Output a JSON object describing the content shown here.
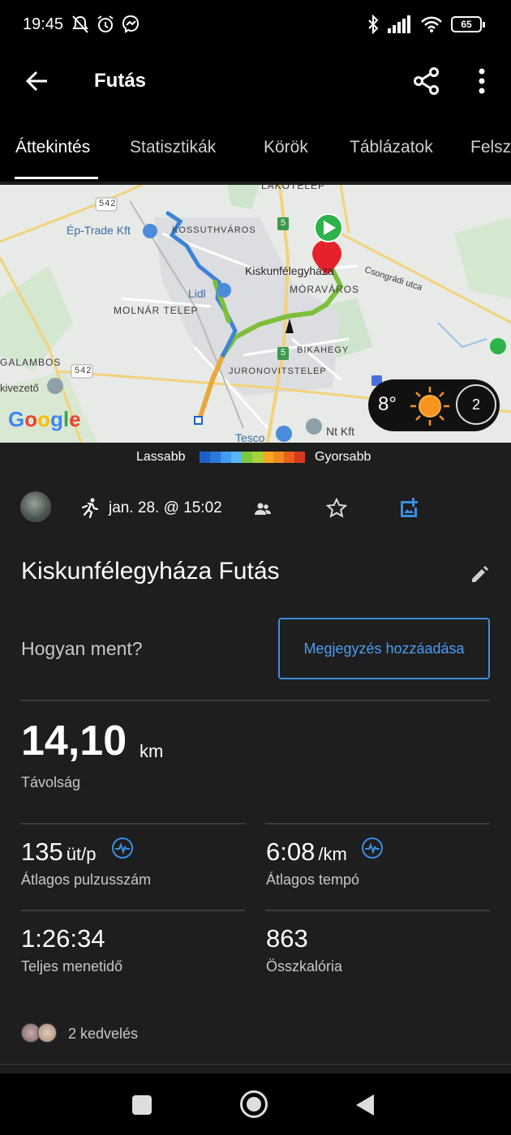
{
  "status_bar": {
    "time": "19:45",
    "battery": "65",
    "icons": [
      "mute-bell-icon",
      "alarm-icon",
      "messenger-icon",
      "bluetooth-icon",
      "signal-icon",
      "wifi-icon",
      "battery-icon"
    ]
  },
  "app_bar": {
    "title": "Futás",
    "icons": [
      "back-arrow-icon",
      "share-icon",
      "more-vert-icon"
    ]
  },
  "tabs": [
    {
      "label": "Áttekintés",
      "active": true
    },
    {
      "label": "Statisztikák",
      "active": false
    },
    {
      "label": "Körök",
      "active": false
    },
    {
      "label": "Táblázatok",
      "active": false
    },
    {
      "label": "Felsz",
      "active": false
    }
  ],
  "map": {
    "labels": {
      "lakotelep": "LAKÓTELEP",
      "road_542_top": "542",
      "ep_trade": "Ép-Trade Kft",
      "kossuthvaros": "KOSSUTHVÁROS",
      "road_5_top": "5",
      "city": "Kiskunfélegyháza",
      "csongradi": "Csongrádi utca",
      "moravaros": "MÓRAVÁROS",
      "lidl": "Lidl",
      "molnar_telep": "MOLNÁR TELEP",
      "bikahegy": "BIKAHEGY",
      "road_5_bottom": "5",
      "galambos": "GALAMBOS",
      "road_542_bottom": "542",
      "juronovits": "JURONOVITSTELEP",
      "kivezeto": "kivezető",
      "tesco": "Tesco",
      "nt_kft": "Nt Kft",
      "google": "Google"
    },
    "weather": {
      "temperature": "8°",
      "wind": "2",
      "icons": [
        "sun-icon",
        "wind-direction-icon"
      ]
    }
  },
  "pace_legend": {
    "slow": "Lassabb",
    "fast": "Gyorsabb",
    "colors": [
      "#1d5fc8",
      "#2b78dc",
      "#3f9cf0",
      "#5bb5f5",
      "#7ac943",
      "#a6d33a",
      "#f5a623",
      "#f28a1f",
      "#e8601c",
      "#d63a1e"
    ]
  },
  "activity": {
    "datetime": "jan. 28. @ 15:02",
    "title": "Kiskunfélegyháza Futás",
    "icons": [
      "avatar",
      "running-icon",
      "people-icon",
      "star-icon",
      "add-photo-icon",
      "edit-pencil-icon"
    ]
  },
  "feel": {
    "question": "Hogyan ment?",
    "note_button": "Megjegyzés hozzáadása"
  },
  "stats": {
    "distance": {
      "value": "14,10",
      "unit": "km",
      "label": "Távolság"
    },
    "heart_rate": {
      "value": "135",
      "unit": "üt/p",
      "label": "Átlagos pulzusszám"
    },
    "pace": {
      "value": "6:08",
      "unit": "/km",
      "label": "Átlagos tempó"
    },
    "time": {
      "value": "1:26:34",
      "label": "Teljes menetidő"
    },
    "calories": {
      "value": "863",
      "label": "Összkalória"
    }
  },
  "likes": {
    "text": "2 kedvelés"
  }
}
